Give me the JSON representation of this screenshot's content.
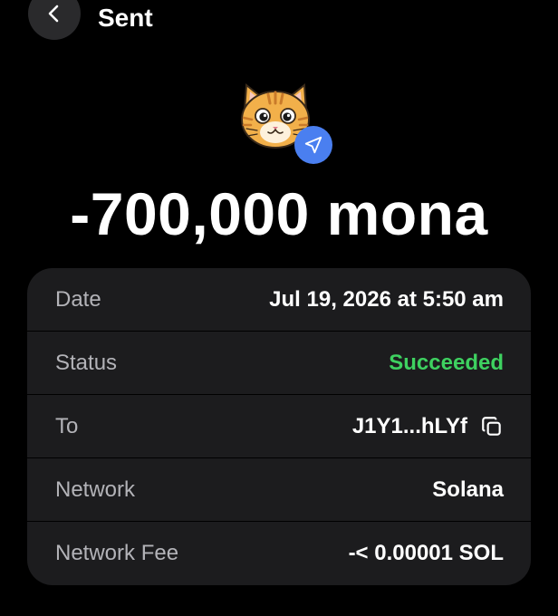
{
  "header": {
    "title": "Sent",
    "back_icon": "chevron-left-icon"
  },
  "token": {
    "logo_icon": "cat-token-logo",
    "badge_icon": "send-arrow-icon",
    "badge_color": "#4a7ff0"
  },
  "amount": "-700,000 mona",
  "details": {
    "date_label": "Date",
    "date_value": "Jul 19, 2026 at 5:50 am",
    "status_label": "Status",
    "status_value": "Succeeded",
    "status_color": "#3ed160",
    "to_label": "To",
    "to_value": "J1Y1...hLYf",
    "to_copy_icon": "copy-icon",
    "network_label": "Network",
    "network_value": "Solana",
    "fee_label": "Network Fee",
    "fee_value": "-< 0.00001 SOL"
  }
}
